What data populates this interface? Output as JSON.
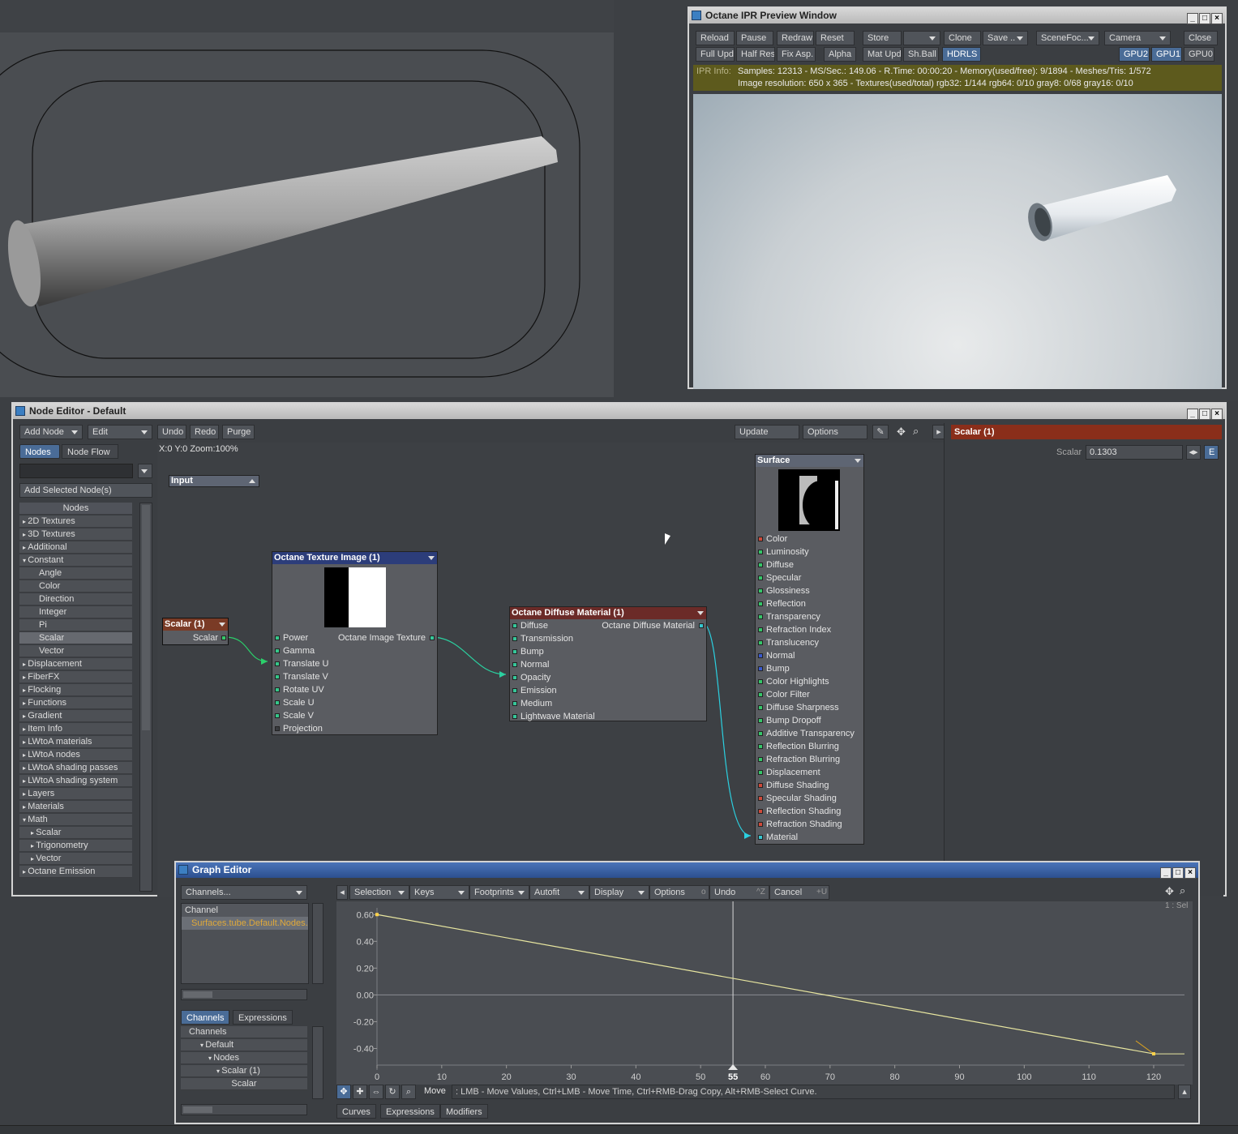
{
  "ipr": {
    "title": "Octane IPR Preview Window",
    "row1": [
      "Reload",
      "Pause",
      "Redraw",
      "Reset",
      "Store",
      "",
      "Clone",
      "Save ..",
      "SceneFoc...",
      "Camera",
      "Close"
    ],
    "row2": [
      "Full Upd.",
      "Half Res",
      "Fix Asp.",
      "Alpha",
      "Mat Upd",
      "Sh.Ball",
      "HDRLS",
      "GPU2",
      "GPU1",
      "GPU0"
    ],
    "info_label": "IPR Info:",
    "info_line1": "Samples: 12313  -  MS/Sec.: 149.06  -  R.Time: 00:00:20 - Memory(used/free): 9/1894  -  Meshes/Tris: 1/572",
    "info_line2": "Image resolution: 650 x 365 - Textures(used/total) rgb32: 1/144  rgb64: 0/10  gray8: 0/68  gray16: 0/10"
  },
  "node_editor": {
    "title": "Node Editor - Default",
    "toolbar": {
      "add_node": "Add Node",
      "edit": "Edit",
      "undo": "Undo",
      "redo": "Redo",
      "purge": "Purge",
      "update": "Update",
      "options": "Options"
    },
    "tabs": {
      "nodes": "Nodes",
      "node_flow": "Node Flow"
    },
    "add_selected": "Add Selected Node(s)",
    "list_header": "Nodes",
    "list": [
      {
        "label": "2D Textures",
        "type": "closed"
      },
      {
        "label": "3D Textures",
        "type": "closed"
      },
      {
        "label": "Additional",
        "type": "closed"
      },
      {
        "label": "Constant",
        "type": "open"
      },
      {
        "label": "Angle",
        "type": "child"
      },
      {
        "label": "Color",
        "type": "child"
      },
      {
        "label": "Direction",
        "type": "child"
      },
      {
        "label": "Integer",
        "type": "child"
      },
      {
        "label": "Pi",
        "type": "child"
      },
      {
        "label": "Scalar",
        "type": "child-sel"
      },
      {
        "label": "Vector",
        "type": "child"
      },
      {
        "label": "Displacement",
        "type": "closed"
      },
      {
        "label": "FiberFX",
        "type": "closed"
      },
      {
        "label": "Flocking",
        "type": "closed"
      },
      {
        "label": "Functions",
        "type": "closed"
      },
      {
        "label": "Gradient",
        "type": "closed"
      },
      {
        "label": "Item Info",
        "type": "closed"
      },
      {
        "label": "LWtoA materials",
        "type": "closed"
      },
      {
        "label": "LWtoA nodes",
        "type": "closed"
      },
      {
        "label": "LWtoA shading passes",
        "type": "closed"
      },
      {
        "label": "LWtoA shading system",
        "type": "closed"
      },
      {
        "label": "Layers",
        "type": "closed"
      },
      {
        "label": "Materials",
        "type": "closed"
      },
      {
        "label": "Math",
        "type": "open"
      },
      {
        "label": "Scalar",
        "type": "sub"
      },
      {
        "label": "Trigonometry",
        "type": "sub"
      },
      {
        "label": "Vector",
        "type": "sub"
      },
      {
        "label": "Octane Emission",
        "type": "closed"
      }
    ],
    "coords": "X:0 Y:0 Zoom:100%",
    "input_label": "Input",
    "scalar_node": {
      "title": "Scalar (1)",
      "port": "Scalar"
    },
    "texture_node": {
      "title": "Octane Texture Image (1)",
      "output": "Octane Image Texture",
      "ports": [
        "Power",
        "Gamma",
        "Translate U",
        "Translate V",
        "Rotate UV",
        "Scale U",
        "Scale V",
        "Projection"
      ]
    },
    "diffuse_node": {
      "title": "Octane Diffuse Material (1)",
      "output": "Octane Diffuse Material",
      "ports": [
        "Diffuse",
        "Transmission",
        "Bump",
        "Normal",
        "Opacity",
        "Emission",
        "Medium",
        "Lightwave Material"
      ]
    },
    "surface_node": {
      "title": "Surface",
      "ports": [
        "Color",
        "Luminosity",
        "Diffuse",
        "Specular",
        "Glossiness",
        "Reflection",
        "Transparency",
        "Refraction Index",
        "Translucency",
        "Normal",
        "Bump",
        "Color Highlights",
        "Color Filter",
        "Diffuse Sharpness",
        "Bump Dropoff",
        "Additive Transparency",
        "Reflection Blurring",
        "Refraction Blurring",
        "Displacement",
        "Diffuse Shading",
        "Specular Shading",
        "Reflection Shading",
        "Refraction Shading",
        "Material"
      ]
    },
    "props": {
      "header": "Scalar (1)",
      "label": "Scalar",
      "value": "0.1303",
      "env_label": "E"
    }
  },
  "graph_editor": {
    "title": "Graph Editor",
    "channels_dropdown": "Channels...",
    "channel_header": "Channel",
    "channel_item": "Surfaces.tube.Default.Nodes.S",
    "tabs": {
      "channels": "Channels",
      "expressions": "Expressions"
    },
    "tree": [
      "Channels",
      "Default",
      "Nodes",
      "Scalar (1)",
      "Scalar"
    ],
    "toolbar": [
      "Selection",
      "Keys",
      "Footprints",
      "Autofit",
      "Display",
      "Options",
      "Undo",
      "Cancel"
    ],
    "shortcuts": {
      "options": "o",
      "undo": "^Z",
      "cancel": "+U"
    },
    "sel_label": "1 : Sel",
    "status_mode": "Move",
    "status_text": ":  LMB - Move Values, Ctrl+LMB - Move Time, Ctrl+RMB-Drag Copy, Alt+RMB-Select Curve.",
    "bottom_tabs": [
      "Curves",
      "Expressions",
      "Modifiers"
    ],
    "current_frame": "55"
  },
  "chart_data": {
    "type": "line",
    "series": [
      {
        "x": [
          0,
          120
        ],
        "y": [
          0.6,
          -0.44
        ]
      }
    ],
    "xticks": [
      0,
      10,
      20,
      30,
      40,
      50,
      55,
      60,
      70,
      80,
      90,
      100,
      110,
      120
    ],
    "yticks": [
      0.6,
      0.4,
      0.2,
      0.0,
      -0.2,
      -0.4
    ],
    "ytick_labels": [
      "0.60",
      "0.40",
      "0.20",
      "0.00",
      "-0.20",
      "-0.40"
    ],
    "xlim": [
      0,
      125
    ],
    "ylim": [
      -0.5,
      0.65
    ],
    "current_frame": 55,
    "grid": false,
    "colors": {
      "curve": "#e8e6a0",
      "key": "#ffd24a"
    }
  }
}
